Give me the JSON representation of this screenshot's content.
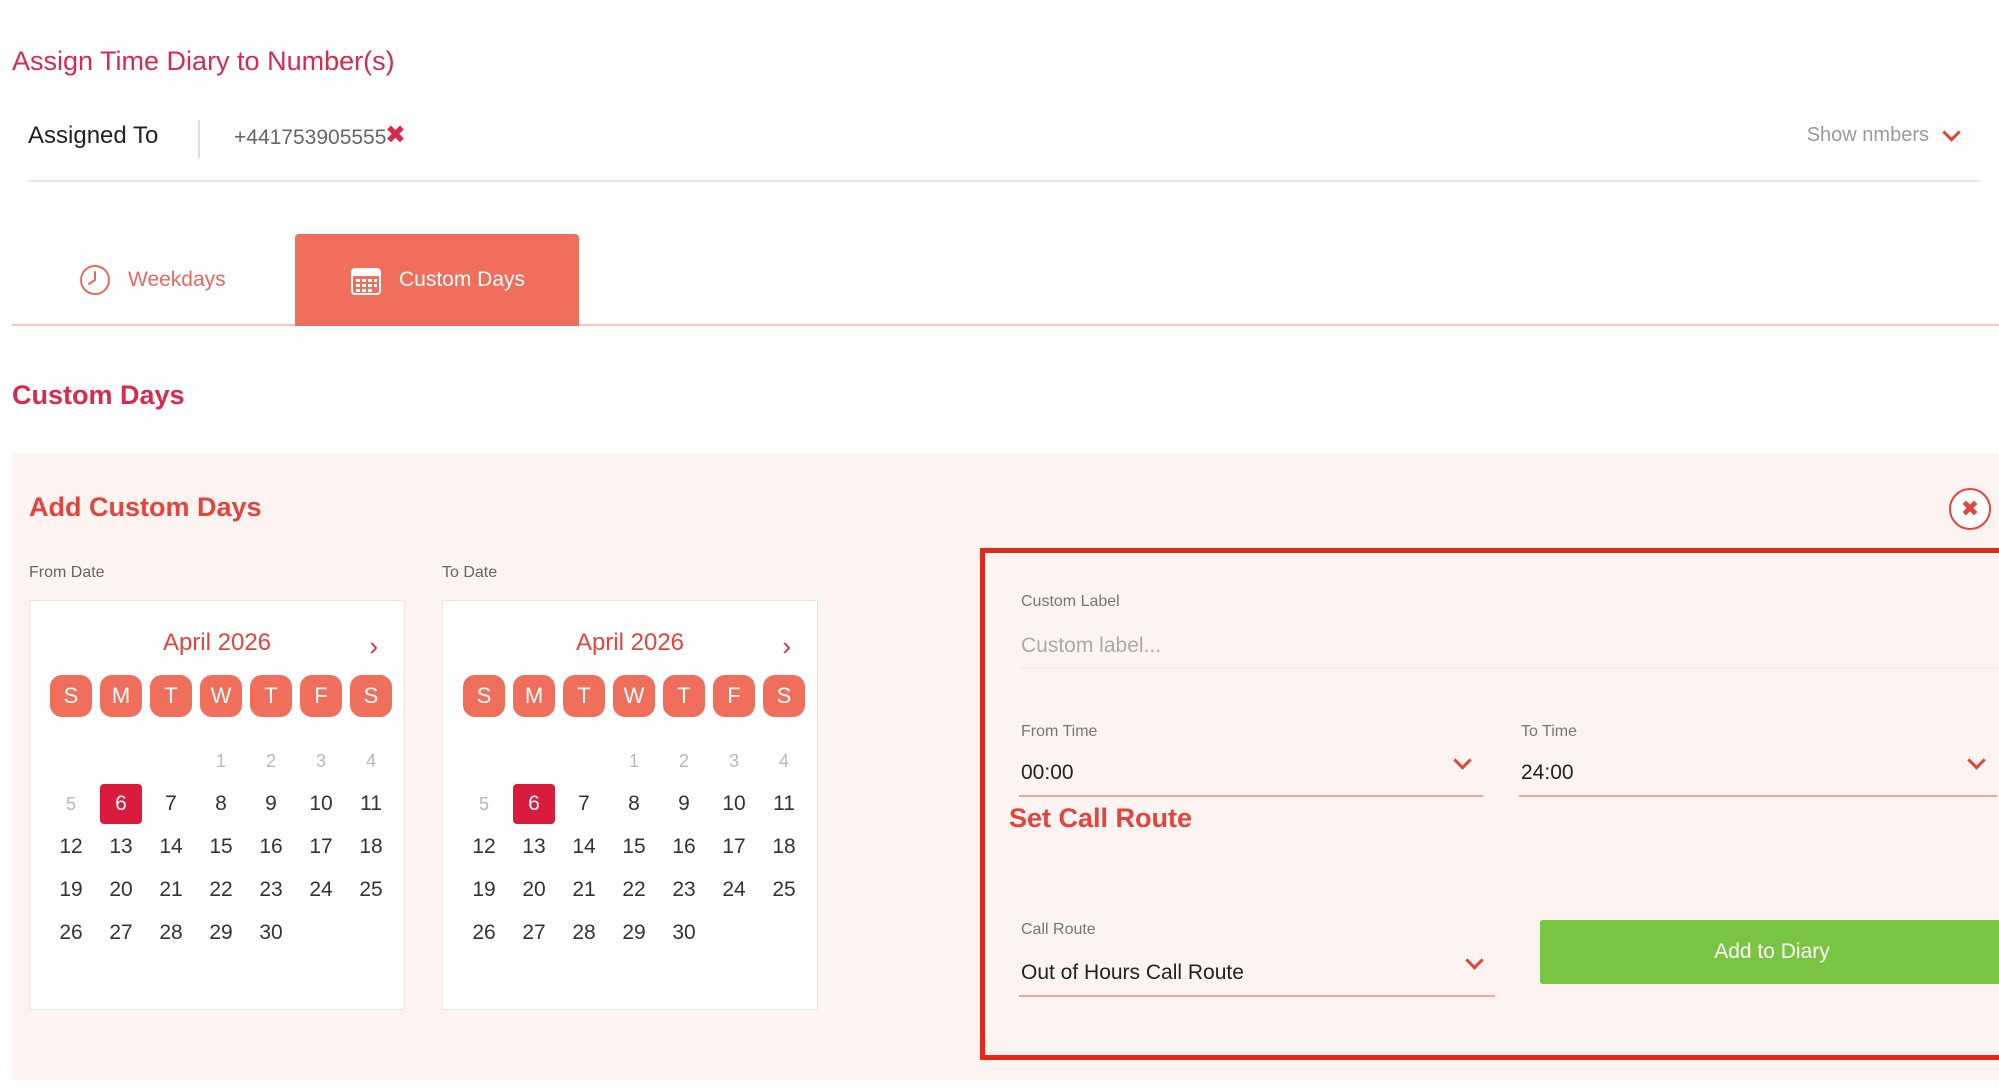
{
  "header": {
    "title": "Assign Time Diary to Number(s)",
    "assigned_label": "Assigned To",
    "assigned_number": "+441753905555",
    "show_numbers": "Show nmbers"
  },
  "tabs": {
    "weekdays": "Weekdays",
    "custom_days": "Custom Days",
    "active": "Custom Days"
  },
  "section_title": "Custom Days",
  "panel": {
    "title": "Add Custom Days",
    "from_date_label": "From Date",
    "to_date_label": "To Date"
  },
  "calendar": {
    "month": "April 2026",
    "weekdays": [
      "S",
      "M",
      "T",
      "W",
      "T",
      "F",
      "S"
    ],
    "weeks": [
      [
        "",
        "",
        "",
        "1",
        "2",
        "3",
        "4"
      ],
      [
        "5",
        "6",
        "7",
        "8",
        "9",
        "10",
        "11"
      ],
      [
        "12",
        "13",
        "14",
        "15",
        "16",
        "17",
        "18"
      ],
      [
        "19",
        "20",
        "21",
        "22",
        "23",
        "24",
        "25"
      ],
      [
        "26",
        "27",
        "28",
        "29",
        "30",
        "",
        ""
      ]
    ],
    "selected_day": "6",
    "muted_days": [
      "1",
      "2",
      "3",
      "4",
      "5"
    ]
  },
  "form": {
    "custom_label_caption": "Custom Label",
    "custom_label_placeholder": "Custom label...",
    "from_time_caption": "From Time",
    "from_time_value": "00:00",
    "to_time_caption": "To Time",
    "to_time_value": "24:00",
    "set_call_route": "Set Call Route",
    "call_route_caption": "Call Route",
    "call_route_value": "Out of Hours Call Route",
    "add_button": "Add to Diary"
  },
  "colors": {
    "title_red": "#d62b4f",
    "accent_coral": "#f06e5c",
    "highlight_border": "#e3281c",
    "button_green": "#79c443"
  }
}
